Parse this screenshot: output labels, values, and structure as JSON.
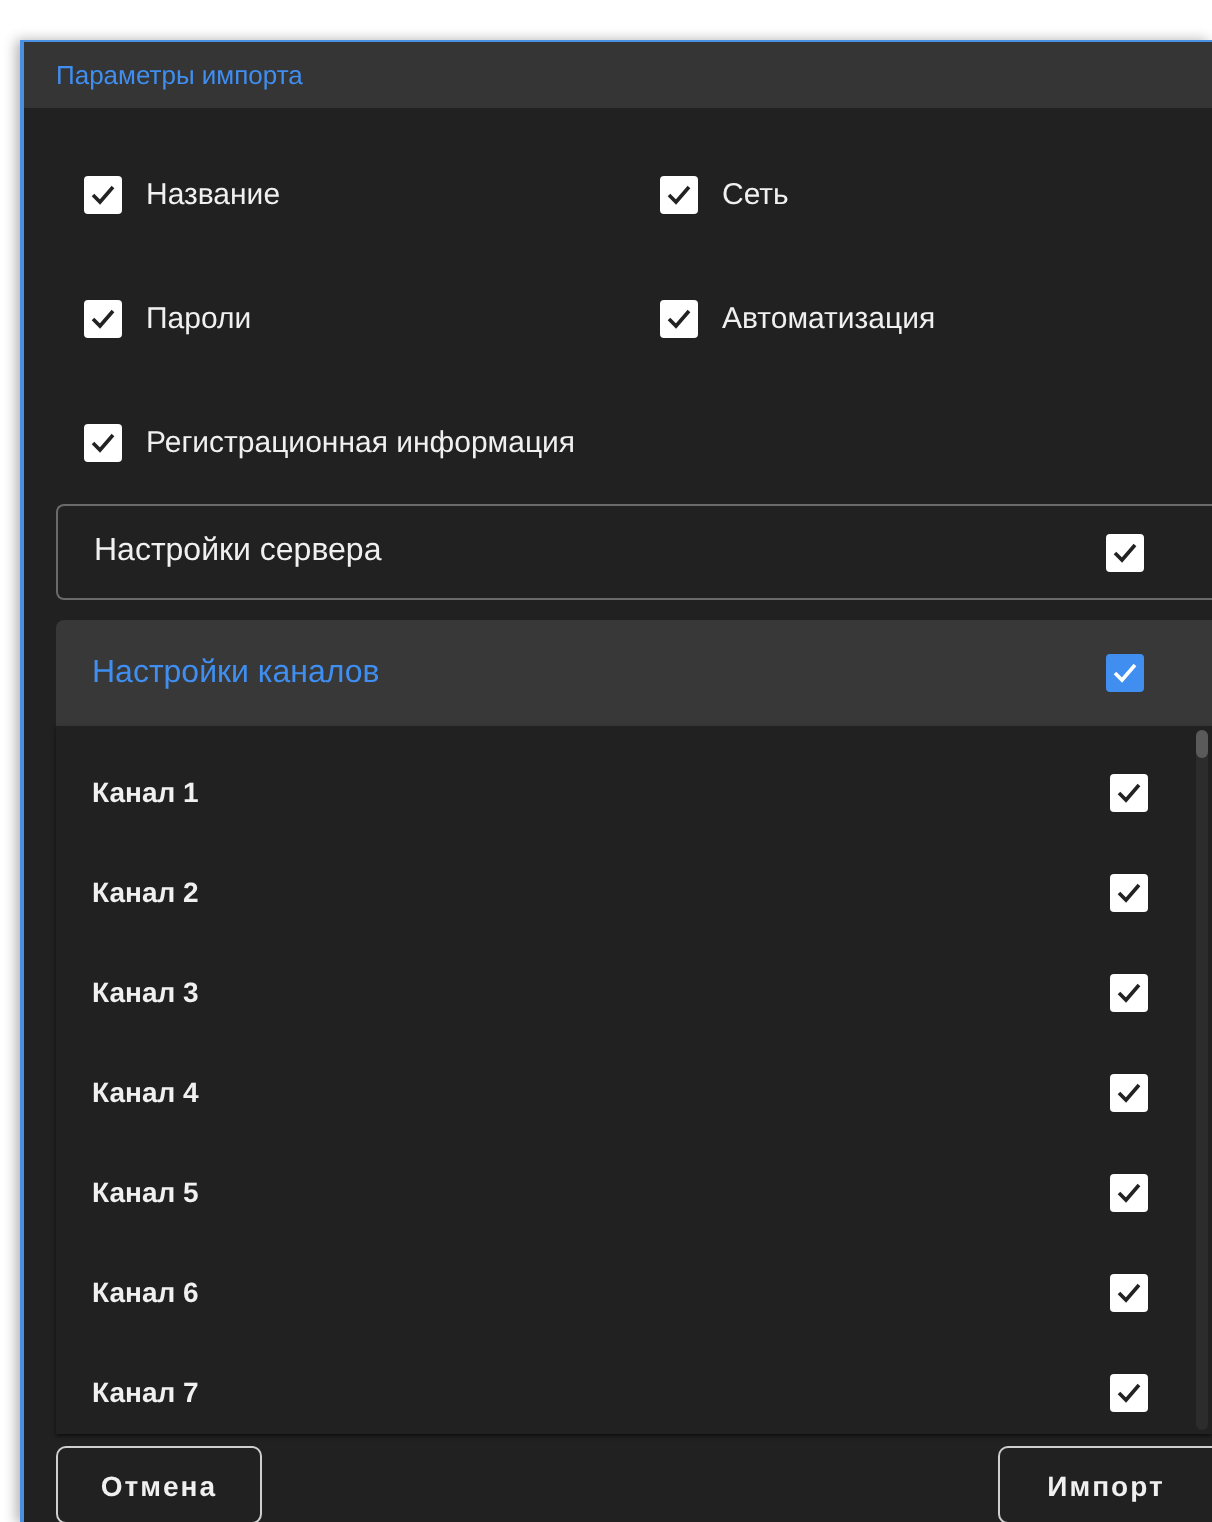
{
  "dialog": {
    "title": "Параметры импорта"
  },
  "options": [
    {
      "label": "Название",
      "checked": true
    },
    {
      "label": "Сеть",
      "checked": true
    },
    {
      "label": "Пароли",
      "checked": true
    },
    {
      "label": "Автоматизация",
      "checked": true
    },
    {
      "label": "Регистрационная информация",
      "checked": true
    }
  ],
  "server_settings": {
    "label": "Настройки сервера",
    "checked": true
  },
  "channel_settings": {
    "label": "Настройки каналов",
    "checked": true,
    "expanded": true,
    "channels": [
      {
        "label": "Канал 1",
        "checked": true
      },
      {
        "label": "Канал 2",
        "checked": true
      },
      {
        "label": "Канал 3",
        "checked": true
      },
      {
        "label": "Канал 4",
        "checked": true
      },
      {
        "label": "Канал 5",
        "checked": true
      },
      {
        "label": "Канал 6",
        "checked": true
      },
      {
        "label": "Канал 7",
        "checked": true
      }
    ]
  },
  "buttons": [
    {
      "label": "Отмена"
    },
    {
      "label": "Импорт"
    }
  ]
}
